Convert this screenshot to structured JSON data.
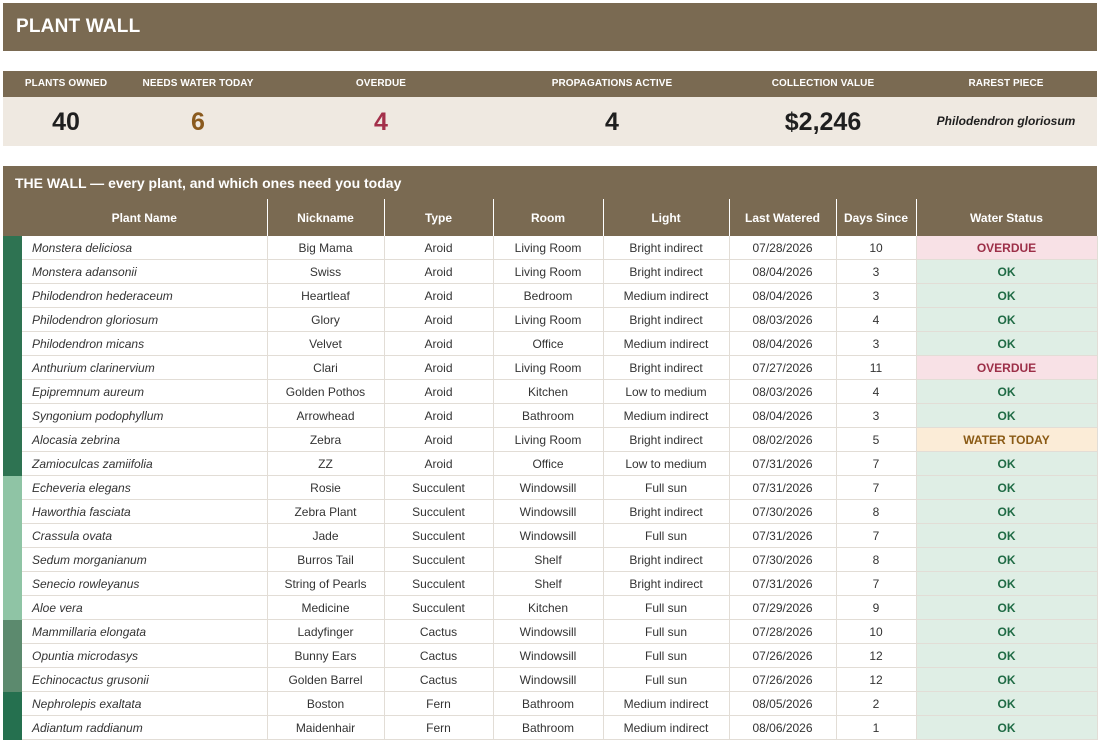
{
  "app": {
    "title": "PLANT WALL"
  },
  "kpis": [
    {
      "label": "PLANTS OWNED",
      "value": "40",
      "color": "#1f1f1f"
    },
    {
      "label": "NEEDS WATER TODAY",
      "value": "6",
      "color": "#8a5a1e"
    },
    {
      "label": "OVERDUE",
      "value": "4",
      "color": "#a3304a"
    },
    {
      "label": "PROPAGATIONS ACTIVE",
      "value": "4",
      "color": "#1f1f1f"
    },
    {
      "label": "COLLECTION VALUE",
      "value": "$2,246",
      "color": "#1f1f1f"
    },
    {
      "label": "RAREST PIECE",
      "value": "Philodendron gloriosum",
      "color": "#1f1f1f"
    }
  ],
  "wall": {
    "heading": "THE WALL — every plant, and which ones need you today",
    "columns": [
      "Plant Name",
      "Nickname",
      "Type",
      "Room",
      "Light",
      "Last Watered",
      "Days Since",
      "Water Status"
    ],
    "type_colors": {
      "Aroid": "#2e7352",
      "Succulent": "#8fc4a5",
      "Cactus": "#5c8a6e",
      "Fern": "#25704f"
    },
    "status_styles": {
      "OVERDUE": {
        "bg": "#f8e1e6",
        "fg": "#9c2f48"
      },
      "OK": {
        "bg": "#dfeee5",
        "fg": "#1f6b45"
      },
      "WATER TODAY": {
        "bg": "#fbecd7",
        "fg": "#8a5a14"
      }
    },
    "rows": [
      {
        "name": "Monstera deliciosa",
        "nickname": "Big Mama",
        "type": "Aroid",
        "room": "Living Room",
        "light": "Bright indirect",
        "last_watered": "07/28/2026",
        "days_since": "10",
        "status": "OVERDUE"
      },
      {
        "name": "Monstera adansonii",
        "nickname": "Swiss",
        "type": "Aroid",
        "room": "Living Room",
        "light": "Bright indirect",
        "last_watered": "08/04/2026",
        "days_since": "3",
        "status": "OK"
      },
      {
        "name": "Philodendron hederaceum",
        "nickname": "Heartleaf",
        "type": "Aroid",
        "room": "Bedroom",
        "light": "Medium indirect",
        "last_watered": "08/04/2026",
        "days_since": "3",
        "status": "OK"
      },
      {
        "name": "Philodendron gloriosum",
        "nickname": "Glory",
        "type": "Aroid",
        "room": "Living Room",
        "light": "Bright indirect",
        "last_watered": "08/03/2026",
        "days_since": "4",
        "status": "OK"
      },
      {
        "name": "Philodendron micans",
        "nickname": "Velvet",
        "type": "Aroid",
        "room": "Office",
        "light": "Medium indirect",
        "last_watered": "08/04/2026",
        "days_since": "3",
        "status": "OK"
      },
      {
        "name": "Anthurium clarinervium",
        "nickname": "Clari",
        "type": "Aroid",
        "room": "Living Room",
        "light": "Bright indirect",
        "last_watered": "07/27/2026",
        "days_since": "11",
        "status": "OVERDUE"
      },
      {
        "name": "Epipremnum aureum",
        "nickname": "Golden Pothos",
        "type": "Aroid",
        "room": "Kitchen",
        "light": "Low to medium",
        "last_watered": "08/03/2026",
        "days_since": "4",
        "status": "OK"
      },
      {
        "name": "Syngonium podophyllum",
        "nickname": "Arrowhead",
        "type": "Aroid",
        "room": "Bathroom",
        "light": "Medium indirect",
        "last_watered": "08/04/2026",
        "days_since": "3",
        "status": "OK"
      },
      {
        "name": "Alocasia zebrina",
        "nickname": "Zebra",
        "type": "Aroid",
        "room": "Living Room",
        "light": "Bright indirect",
        "last_watered": "08/02/2026",
        "days_since": "5",
        "status": "WATER TODAY"
      },
      {
        "name": "Zamioculcas zamiifolia",
        "nickname": "ZZ",
        "type": "Aroid",
        "room": "Office",
        "light": "Low to medium",
        "last_watered": "07/31/2026",
        "days_since": "7",
        "status": "OK"
      },
      {
        "name": "Echeveria elegans",
        "nickname": "Rosie",
        "type": "Succulent",
        "room": "Windowsill",
        "light": "Full sun",
        "last_watered": "07/31/2026",
        "days_since": "7",
        "status": "OK"
      },
      {
        "name": "Haworthia fasciata",
        "nickname": "Zebra Plant",
        "type": "Succulent",
        "room": "Windowsill",
        "light": "Bright indirect",
        "last_watered": "07/30/2026",
        "days_since": "8",
        "status": "OK"
      },
      {
        "name": "Crassula ovata",
        "nickname": "Jade",
        "type": "Succulent",
        "room": "Windowsill",
        "light": "Full sun",
        "last_watered": "07/31/2026",
        "days_since": "7",
        "status": "OK"
      },
      {
        "name": "Sedum morganianum",
        "nickname": "Burros Tail",
        "type": "Succulent",
        "room": "Shelf",
        "light": "Bright indirect",
        "last_watered": "07/30/2026",
        "days_since": "8",
        "status": "OK"
      },
      {
        "name": "Senecio rowleyanus",
        "nickname": "String of Pearls",
        "type": "Succulent",
        "room": "Shelf",
        "light": "Bright indirect",
        "last_watered": "07/31/2026",
        "days_since": "7",
        "status": "OK"
      },
      {
        "name": "Aloe vera",
        "nickname": "Medicine",
        "type": "Succulent",
        "room": "Kitchen",
        "light": "Full sun",
        "last_watered": "07/29/2026",
        "days_since": "9",
        "status": "OK"
      },
      {
        "name": "Mammillaria elongata",
        "nickname": "Ladyfinger",
        "type": "Cactus",
        "room": "Windowsill",
        "light": "Full sun",
        "last_watered": "07/28/2026",
        "days_since": "10",
        "status": "OK"
      },
      {
        "name": "Opuntia microdasys",
        "nickname": "Bunny Ears",
        "type": "Cactus",
        "room": "Windowsill",
        "light": "Full sun",
        "last_watered": "07/26/2026",
        "days_since": "12",
        "status": "OK"
      },
      {
        "name": "Echinocactus grusonii",
        "nickname": "Golden Barrel",
        "type": "Cactus",
        "room": "Windowsill",
        "light": "Full sun",
        "last_watered": "07/26/2026",
        "days_since": "12",
        "status": "OK"
      },
      {
        "name": "Nephrolepis exaltata",
        "nickname": "Boston",
        "type": "Fern",
        "room": "Bathroom",
        "light": "Medium indirect",
        "last_watered": "08/05/2026",
        "days_since": "2",
        "status": "OK"
      },
      {
        "name": "Adiantum raddianum",
        "nickname": "Maidenhair",
        "type": "Fern",
        "room": "Bathroom",
        "light": "Medium indirect",
        "last_watered": "08/06/2026",
        "days_since": "1",
        "status": "OK"
      }
    ]
  }
}
